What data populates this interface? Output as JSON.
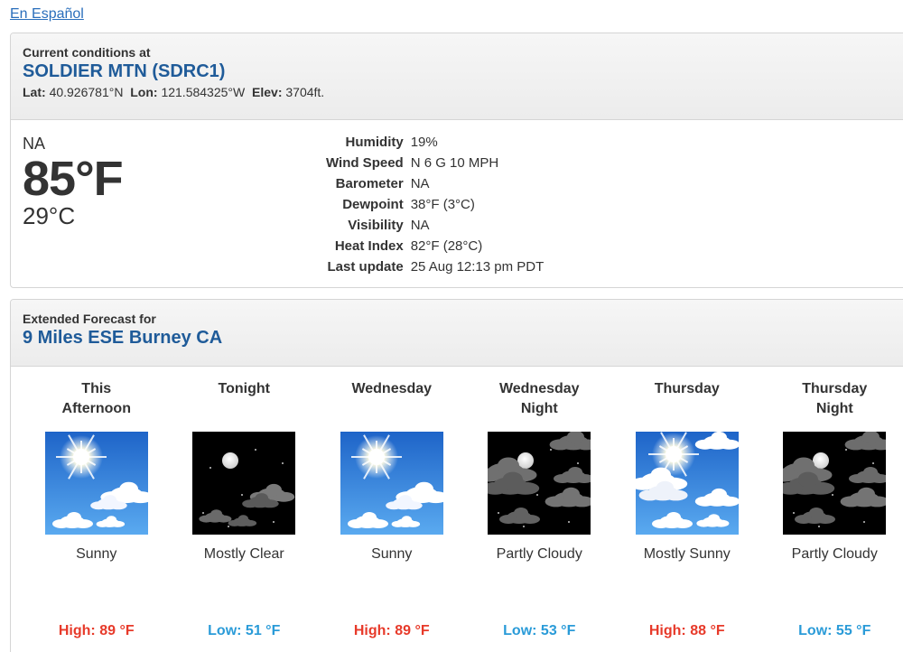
{
  "header": {
    "lang_link": "En Español"
  },
  "current": {
    "kicker": "Current conditions at",
    "station": "SOLDIER MTN (SDRC1)",
    "lat_label": "Lat:",
    "lat": "40.926781°N",
    "lon_label": "Lon:",
    "lon": "121.584325°W",
    "elev_label": "Elev:",
    "elev": "3704ft.",
    "condition": "NA",
    "temp_f": "85°F",
    "temp_c": "29°C",
    "details": [
      {
        "label": "Humidity",
        "value": "19%"
      },
      {
        "label": "Wind Speed",
        "value": "N 6 G 10 MPH"
      },
      {
        "label": "Barometer",
        "value": "NA"
      },
      {
        "label": "Dewpoint",
        "value": "38°F (3°C)"
      },
      {
        "label": "Visibility",
        "value": "NA"
      },
      {
        "label": "Heat Index",
        "value": "82°F (28°C)"
      },
      {
        "label": "Last update",
        "value": "25 Aug 12:13 pm PDT"
      }
    ]
  },
  "forecast": {
    "kicker": "Extended Forecast for",
    "location": "9 Miles ESE Burney CA",
    "periods": [
      {
        "line1": "This",
        "line2": "Afternoon",
        "icon": "sunny-day-icon",
        "short": "Sunny",
        "temp": "High: 89 °F",
        "kind": "high"
      },
      {
        "line1": "Tonight",
        "line2": "",
        "icon": "mostly-clear-night-icon",
        "short": "Mostly Clear",
        "temp": "Low: 51 °F",
        "kind": "low"
      },
      {
        "line1": "Wednesday",
        "line2": "",
        "icon": "sunny-day-icon",
        "short": "Sunny",
        "temp": "High: 89 °F",
        "kind": "high"
      },
      {
        "line1": "Wednesday",
        "line2": "Night",
        "icon": "partly-cloudy-night-icon",
        "short": "Partly Cloudy",
        "temp": "Low: 53 °F",
        "kind": "low"
      },
      {
        "line1": "Thursday",
        "line2": "",
        "icon": "mostly-sunny-day-icon",
        "short": "Mostly Sunny",
        "temp": "High: 88 °F",
        "kind": "high"
      },
      {
        "line1": "Thursday",
        "line2": "Night",
        "icon": "partly-cloudy-night-icon",
        "short": "Partly Cloudy",
        "temp": "Low: 55 °F",
        "kind": "low"
      }
    ]
  },
  "colors": {
    "link": "#2a6ebb",
    "station": "#1f5b99",
    "high": "#e73a2a",
    "low": "#2a9bd8"
  }
}
